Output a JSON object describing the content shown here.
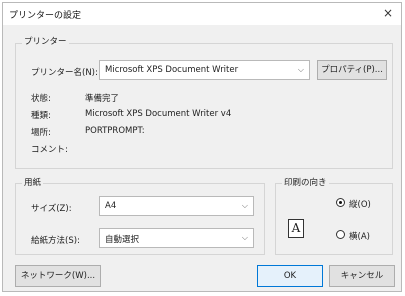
{
  "window": {
    "title": "プリンターの設定",
    "close_glyph": "×"
  },
  "printer": {
    "group_label": "プリンター",
    "name_label": "プリンター名(N):",
    "name_value": "Microsoft XPS Document Writer",
    "properties_button": "プロパティ(P)...",
    "status_label": "状態:",
    "status_value": "準備完了",
    "type_label": "種類:",
    "type_value": "Microsoft XPS Document Writer v4",
    "location_label": "場所:",
    "location_value": "PORTPROMPT:",
    "comment_label": "コメント:"
  },
  "paper": {
    "group_label": "用紙",
    "size_label": "サイズ(Z):",
    "size_value": "A4",
    "source_label": "給紙方法(S):",
    "source_value": "自動選択"
  },
  "orientation": {
    "group_label": "印刷の向き",
    "portrait_label": "縦(O)",
    "portrait_selected": true,
    "landscape_label": "横(A)",
    "landscape_selected": false,
    "preview_glyph": "A"
  },
  "buttons": {
    "network": "ネットワーク(W)...",
    "ok": "OK",
    "cancel": "キャンセル"
  },
  "icons": {
    "dropdown": "chevron-down-icon"
  }
}
